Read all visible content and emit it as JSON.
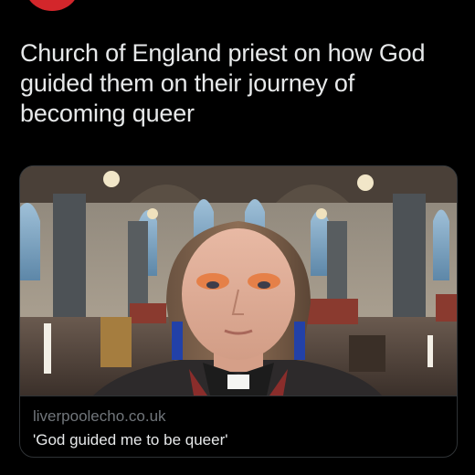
{
  "tweet": {
    "text": "Church of England priest on how God guided them on their journey of becoming queer"
  },
  "link_card": {
    "domain": "liverpoolecho.co.uk",
    "title": "'God guided me to be queer'",
    "image_icon": "photo-priest-in-church"
  },
  "colors": {
    "background": "#000000",
    "text_primary": "#e7e9ea",
    "text_secondary": "#71767b",
    "border": "#2f3336",
    "avatar": "#d3262b"
  }
}
